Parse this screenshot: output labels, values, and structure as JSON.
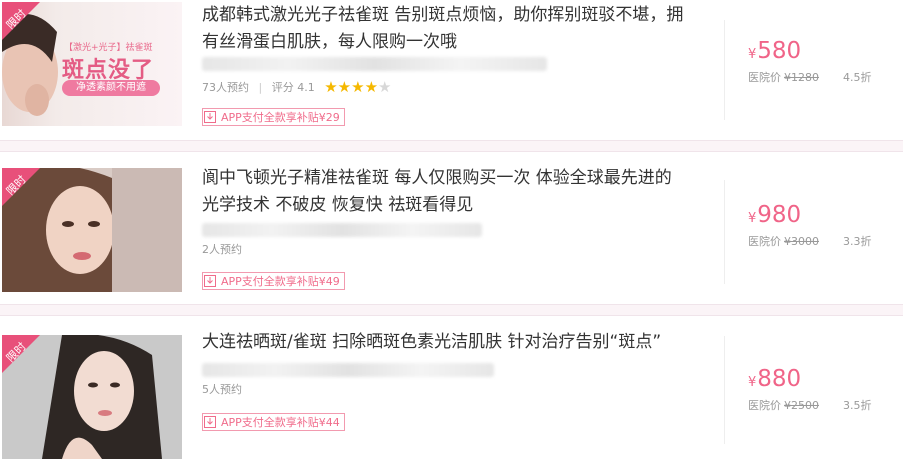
{
  "items": [
    {
      "ribbon": "限时",
      "thumb_text": {
        "tag": "【激光+光子】祛雀斑",
        "headline": "斑点没了",
        "sub": "净透素颜不用遮"
      },
      "title_line1": "成都韩式激光光子祛雀斑 告别斑点烦恼，助你挥别斑驳不堪，拥",
      "title_line2": "有丝滑蛋白肌肤，每人限购一次哦",
      "bookings": "73人预约",
      "score": "评分 4.1",
      "stars": 4,
      "promo": "APP支付全款享补贴¥29",
      "price_currency": "¥",
      "price": "580",
      "orig_label": "医院价",
      "orig_price": "¥1280",
      "discount": "4.5折"
    },
    {
      "ribbon": "限时",
      "title_line1": "阆中飞顿光子精准祛雀斑 每人仅限购买一次 体验全球最先进的",
      "title_line2": "光学技术 不破皮 恢复快 祛斑看得见",
      "bookings": "2人预约",
      "promo": "APP支付全款享补贴¥49",
      "price_currency": "¥",
      "price": "980",
      "orig_label": "医院价",
      "orig_price": "¥3000",
      "discount": "3.3折"
    },
    {
      "ribbon": "限时",
      "title_line1": "大连祛晒斑/雀斑 扫除晒斑色素光洁肌肤 针对治疗告别“斑点”",
      "bookings": "5人预约",
      "promo": "APP支付全款享补贴¥44",
      "price_currency": "¥",
      "price": "880",
      "orig_label": "医院价",
      "orig_price": "¥2500",
      "discount": "3.5折"
    }
  ],
  "colors": {
    "accent": "#f06488",
    "star": "#f5b800",
    "star_empty": "#d8d8d8"
  }
}
